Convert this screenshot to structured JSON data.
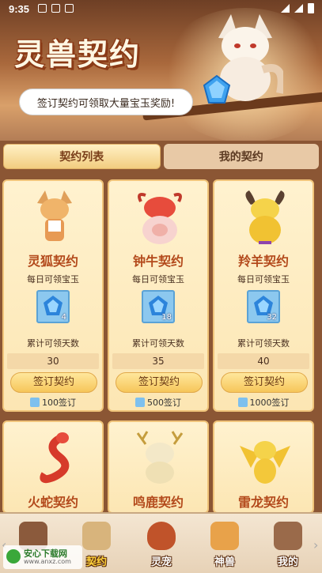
{
  "status_bar": {
    "time": "9:35"
  },
  "banner": {
    "title": "灵兽契约",
    "bubble_text": "签订契约可领取大量宝玉奖励!"
  },
  "tabs": [
    {
      "label": "契约列表",
      "active": true
    },
    {
      "label": "我的契约",
      "active": false
    }
  ],
  "cards": [
    {
      "name": "灵狐契约",
      "daily": "每日可领宝玉",
      "gems": "4",
      "cumulative_label": "累计可领天数",
      "days": "30",
      "sign_label": "签订契约",
      "cost": "100签订"
    },
    {
      "name": "钟牛契约",
      "daily": "每日可领宝玉",
      "gems": "18",
      "cumulative_label": "累计可领天数",
      "days": "35",
      "sign_label": "签订契约",
      "cost": "500签订"
    },
    {
      "name": "羚羊契约",
      "daily": "每日可领宝玉",
      "gems": "32",
      "cumulative_label": "累计可领天数",
      "days": "40",
      "sign_label": "签订契约",
      "cost": "1000签订"
    },
    {
      "name": "火蛇契约"
    },
    {
      "name": "鸣鹿契约"
    },
    {
      "name": "雷龙契约"
    }
  ],
  "bottom_nav": [
    {
      "label": "",
      "icon": "shop-icon"
    },
    {
      "label": "契约",
      "icon": "scroll-icon",
      "active": true
    },
    {
      "label": "灵宠",
      "icon": "egg-icon"
    },
    {
      "label": "神兽",
      "icon": "beast-icon"
    },
    {
      "label": "我的",
      "icon": "profile-icon"
    }
  ],
  "watermark": {
    "line1": "安心下载网",
    "line2": "www.anxz.com"
  },
  "colors": {
    "accent": "#b34a1c",
    "panel": "#8b5634",
    "gem": "#7ec0ee"
  }
}
